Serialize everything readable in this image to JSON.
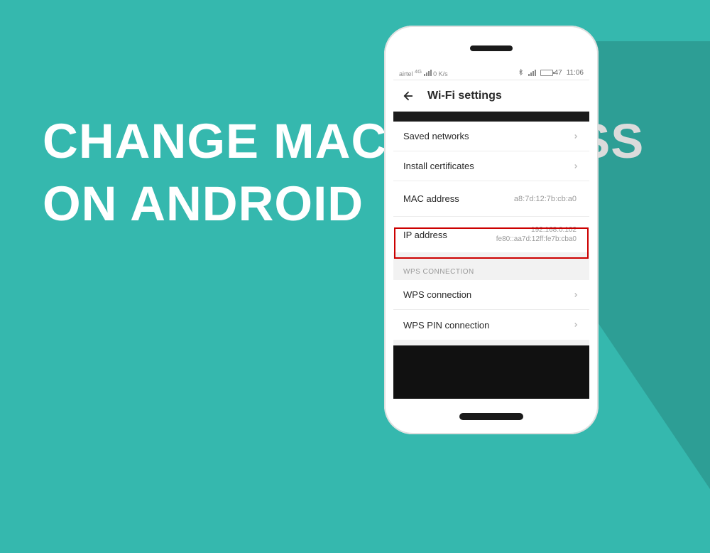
{
  "headline": "CHANGE MAC ADDRESS ON ANDROID",
  "status": {
    "carrier": "airtel",
    "net": "4G",
    "speed": "0 K/s",
    "battery": "47",
    "time": "11:06"
  },
  "titlebar": {
    "title": "Wi-Fi settings"
  },
  "rows1": {
    "saved": {
      "label": "Saved networks"
    },
    "install": {
      "label": "Install certificates"
    },
    "mac": {
      "label": "MAC address",
      "value": "a8:7d:12:7b:cb:a0"
    },
    "ip_label": "IP address",
    "ip_value1": "192.168.0.102",
    "ip_value2": "fe80::aa7d:12ff:fe7b:cba0"
  },
  "section": {
    "wps": "WPS CONNECTION"
  },
  "rows2": {
    "wps": {
      "label": "WPS connection"
    },
    "wpspin": {
      "label": "WPS PIN connection"
    }
  }
}
